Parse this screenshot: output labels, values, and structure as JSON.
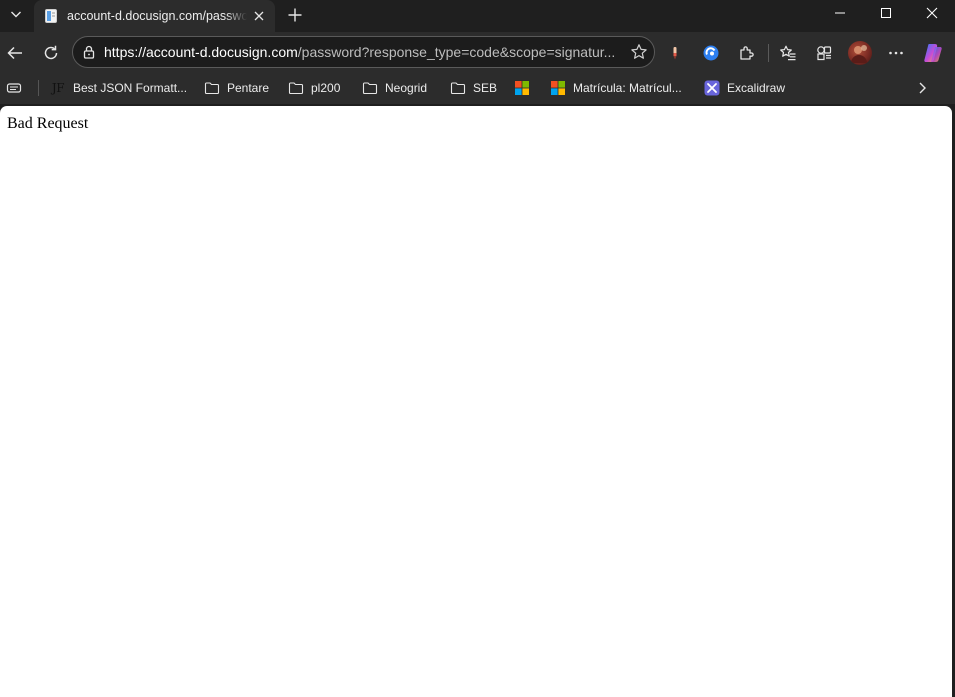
{
  "tab": {
    "title": "account-d.docusign.com/password?response_type=code&scope=signature"
  },
  "omnibox": {
    "url_host": "https://account-d.docusign.com",
    "url_rest": "/password?response_type=code&scope=signatur..."
  },
  "bookmarks": [
    {
      "label": "Best JSON Formatt...",
      "icon": "json-formatter-icon"
    },
    {
      "label": "Pentare",
      "icon": "folder-icon"
    },
    {
      "label": "pl200",
      "icon": "folder-icon"
    },
    {
      "label": "Neogrid",
      "icon": "folder-icon"
    },
    {
      "label": "SEB",
      "icon": "folder-icon"
    },
    {
      "label": "",
      "icon": "microsoft-icon"
    },
    {
      "label": "Matrícula: Matrícul...",
      "icon": "microsoft-icon"
    },
    {
      "label": "Excalidraw",
      "icon": "excalidraw-icon"
    }
  ],
  "bookmark_jf_text": "JF",
  "page": {
    "body_text": "Bad Request"
  },
  "colors": {
    "chrome_dark": "#1f1f1f",
    "toolbar": "#2c2c2c",
    "page_bg": "#ffffff",
    "copilot_gradient": [
      "#2a7bff",
      "#c84bd6",
      "#ffb341"
    ]
  }
}
